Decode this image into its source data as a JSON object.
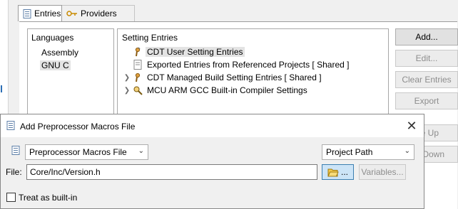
{
  "tabs": [
    {
      "label": "Entries",
      "icon": "entries-icon"
    },
    {
      "label": "Providers",
      "icon": "providers-icon"
    }
  ],
  "languages": {
    "title": "Languages",
    "items": [
      "Assembly",
      "GNU C"
    ],
    "selected": "GNU C"
  },
  "setting_entries": {
    "title": "Setting Entries",
    "items": [
      {
        "label": "CDT User Setting Entries",
        "icon": "user-setting-icon",
        "expandable": false,
        "selected": true
      },
      {
        "label": "Exported Entries from Referenced Projects   [ Shared ]",
        "icon": "exported-entries-icon",
        "expandable": false
      },
      {
        "label": "CDT Managed Build Setting Entries   [ Shared ]",
        "icon": "managed-build-icon",
        "expandable": true
      },
      {
        "label": "MCU ARM GCC Built-in Compiler Settings",
        "icon": "compiler-settings-icon",
        "expandable": true
      }
    ]
  },
  "side_buttons": {
    "add": "Add...",
    "edit": "Edit...",
    "clear": "Clear Entries",
    "export": "Export",
    "move_up_partial": "e Up",
    "move_down_partial": "Down"
  },
  "dialog": {
    "title": "Add Preprocessor Macros File",
    "kind_select": "Preprocessor Macros File",
    "path_type_select": "Project Path",
    "file_label": "File:",
    "file_value": "Core/Inc/Version.h",
    "browse_label": "...",
    "variables_label": "Variables...",
    "treat_builtin_label": "Treat as built-in",
    "treat_builtin_checked": false
  }
}
